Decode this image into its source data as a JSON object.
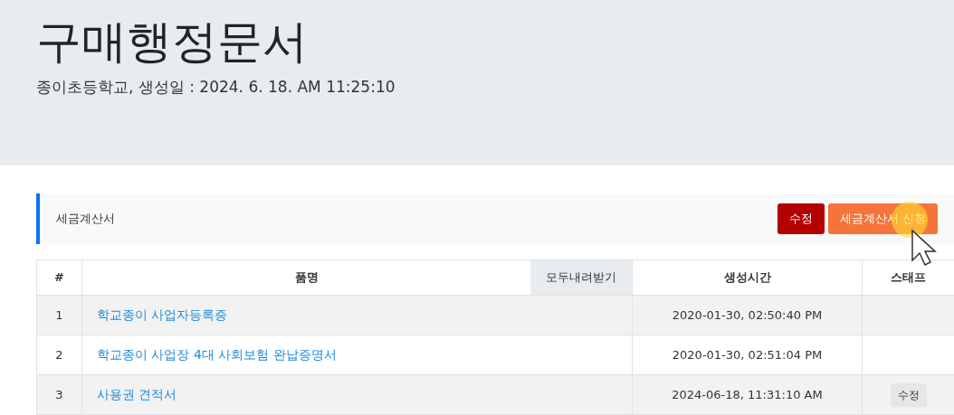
{
  "header": {
    "title": "구매행정문서",
    "subtitle": "종이초등학교, 생성일 : 2024. 6. 18. AM 11:25:10"
  },
  "section": {
    "title": "세금계산서",
    "buttons": [
      {
        "label": "수정",
        "kind": "danger"
      },
      {
        "label": "세금계산서 신청",
        "kind": "warning"
      }
    ]
  },
  "table": {
    "columns": [
      "#",
      "품명",
      "생성시간",
      "스태프"
    ],
    "download_button": "모두내려받기",
    "rows": [
      {
        "index": "1",
        "name": "학교종이 사업자등록증",
        "created": "2020-01-30, 02:50:40 PM"
      },
      {
        "index": "2",
        "name": "학교종이 사업장 4대 사회보험 완납증명서",
        "created": "2020-01-30, 02:51:04 PM"
      },
      {
        "index": "3",
        "name": "사용권 견적서",
        "created": "2024-06-18, 11:31:10 AM",
        "staff": "수정"
      }
    ]
  }
}
